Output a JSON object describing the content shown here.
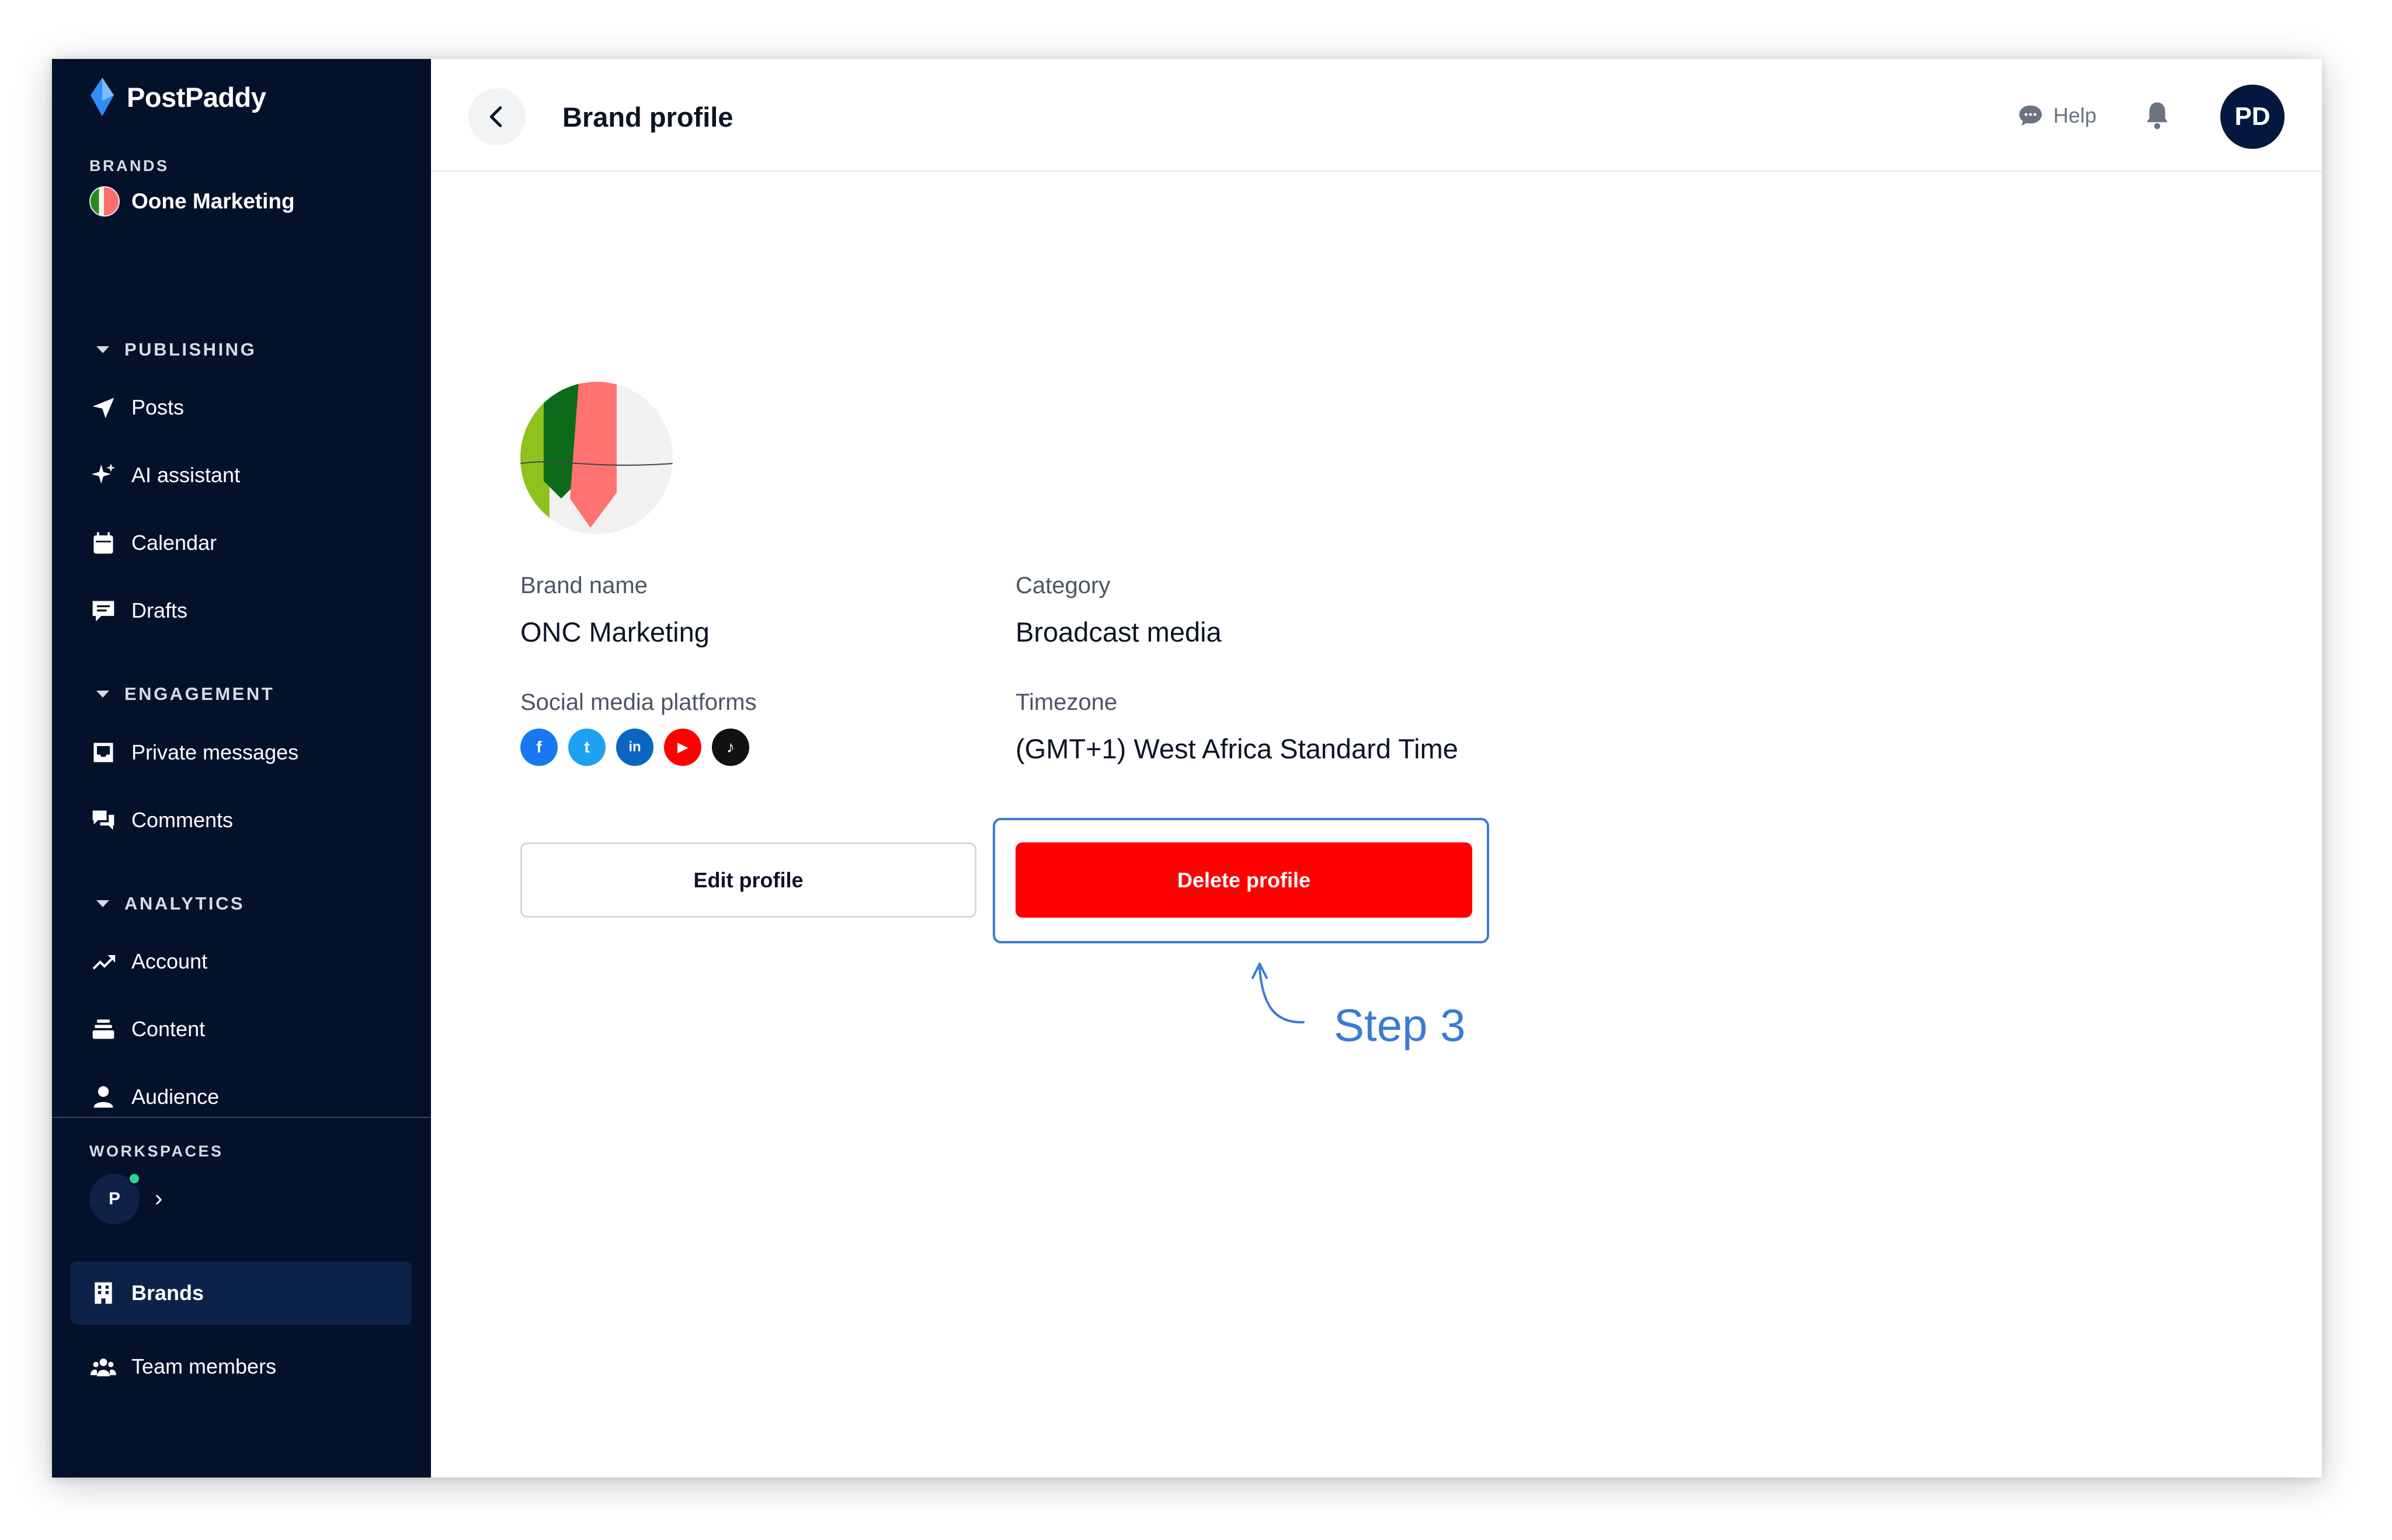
{
  "app": {
    "name": "PostPaddy"
  },
  "sidebar": {
    "brands_label": "BRANDS",
    "current_brand": "Oone Marketing",
    "groups": [
      {
        "label": "PUBLISHING",
        "items": [
          {
            "label": "Posts",
            "icon": "send-icon"
          },
          {
            "label": "AI assistant",
            "icon": "sparkle-icon"
          },
          {
            "label": "Calendar",
            "icon": "calendar-icon"
          },
          {
            "label": "Drafts",
            "icon": "drafts-icon"
          }
        ]
      },
      {
        "label": "ENGAGEMENT",
        "items": [
          {
            "label": "Private messages",
            "icon": "inbox-icon"
          },
          {
            "label": "Comments",
            "icon": "comments-icon"
          }
        ]
      },
      {
        "label": "ANALYTICS",
        "items": [
          {
            "label": "Account",
            "icon": "trending-icon"
          },
          {
            "label": "Content",
            "icon": "stack-icon"
          },
          {
            "label": "Audience",
            "icon": "person-icon"
          }
        ]
      }
    ],
    "workspaces_label": "WORKSPACES",
    "workspace_initial": "P",
    "bottom_items": [
      {
        "label": "Brands",
        "icon": "building-icon",
        "active": true
      },
      {
        "label": "Team members",
        "icon": "team-icon",
        "active": false
      }
    ]
  },
  "header": {
    "title": "Brand profile",
    "help_label": "Help",
    "user_initials": "PD"
  },
  "profile": {
    "brand_name_label": "Brand name",
    "brand_name": "ONC Marketing",
    "category_label": "Category",
    "category": "Broadcast media",
    "socials_label": "Social media platforms",
    "socials": [
      {
        "name": "facebook-icon",
        "glyph": "f",
        "color": "#1877f2"
      },
      {
        "name": "twitter-icon",
        "glyph": "t",
        "color": "#1da1f2"
      },
      {
        "name": "linkedin-icon",
        "glyph": "in",
        "color": "#0a66c2"
      },
      {
        "name": "youtube-icon",
        "glyph": "▶",
        "color": "#ff0000"
      },
      {
        "name": "tiktok-icon",
        "glyph": "♪",
        "color": "#111111"
      }
    ],
    "timezone_label": "Timezone",
    "timezone": "(GMT+1) West Africa Standard Time"
  },
  "actions": {
    "edit_label": "Edit profile",
    "delete_label": "Delete profile"
  },
  "annotation": {
    "step_label": "Step 3"
  },
  "colors": {
    "sidebar_bg": "#04112b",
    "delete": "#ff0000",
    "annotation": "#3a7bd5"
  }
}
